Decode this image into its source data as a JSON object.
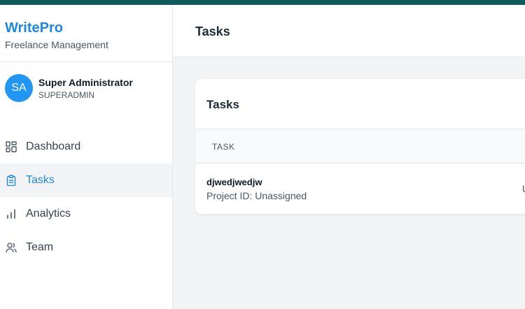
{
  "brand": {
    "title": "WritePro",
    "subtitle": "Freelance Management"
  },
  "user": {
    "initials": "SA",
    "name": "Super Administrator",
    "role": "SUPERADMIN"
  },
  "sidebar": {
    "items": [
      {
        "label": "Dashboard",
        "icon": "dashboard-icon",
        "active": false
      },
      {
        "label": "Tasks",
        "icon": "clipboard-icon",
        "active": true
      },
      {
        "label": "Analytics",
        "icon": "bar-chart-icon",
        "active": false
      },
      {
        "label": "Team",
        "icon": "users-icon",
        "active": false
      }
    ]
  },
  "header": {
    "title": "Tasks"
  },
  "card": {
    "title": "Tasks",
    "columns": [
      "TASK"
    ],
    "rows": [
      {
        "title": "djwedjwedjw",
        "subtitle": "Project ID: Unassigned",
        "status_fragment": "U"
      }
    ]
  },
  "colors": {
    "topbar": "#0f5a5c",
    "accent": "#1e88e5",
    "avatar": "#2196f3"
  }
}
